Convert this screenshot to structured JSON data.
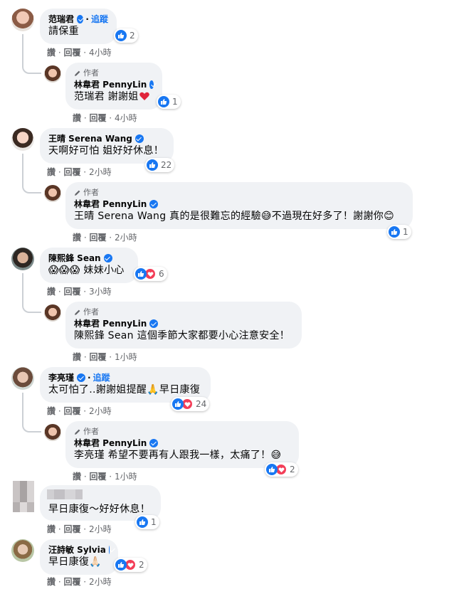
{
  "ui": {
    "follow_label": "追蹤",
    "author_badge": "作者",
    "like_label": "讚",
    "reply_label": "回覆",
    "sep": "·"
  },
  "comments": [
    {
      "name": "范瑞君",
      "verified": true,
      "follow": true,
      "text": "請保重",
      "time": "4小時",
      "reactions": [
        "like"
      ],
      "count": "2",
      "reply": {
        "name": "林韋君 PennyLin",
        "mention": "范瑞君",
        "text": "謝謝姐",
        "emoji": "heart",
        "time": "4小時",
        "reactions": [
          "like"
        ],
        "count": "1"
      }
    },
    {
      "name": "王晴 Serena Wang",
      "verified": true,
      "follow": false,
      "text": "天啊好可怕 姐好好休息！",
      "time": "2小時",
      "reactions": [
        "like"
      ],
      "count": "22",
      "reply": {
        "name": "林韋君 PennyLin",
        "mention": "王晴 Serena Wang",
        "text": "真的是很難忘的經驗😅不過現在好多了！謝謝你😊",
        "time": "2小時",
        "reactions": [
          "like"
        ],
        "count": "1"
      }
    },
    {
      "name": "陳熙鋒 Sean",
      "verified": true,
      "follow": false,
      "text": "😱😱😱 妹妹小心",
      "time": "3小時",
      "reactions": [
        "like",
        "heart"
      ],
      "count": "6",
      "reply": {
        "name": "林韋君 PennyLin",
        "mention": "陳熙鋒 Sean",
        "text": "這個季節大家都要小心注意安全！",
        "time": "1小時",
        "reactions": [],
        "count": ""
      }
    },
    {
      "name": "李亮瑾",
      "verified": true,
      "follow": true,
      "text": "太可怕了..謝謝姐提醒🙏早日康復",
      "time": "2小時",
      "reactions": [
        "like",
        "heart"
      ],
      "count": "24",
      "reply": {
        "name": "林韋君 PennyLin",
        "mention": "李亮瑾",
        "text": "希望不要再有人跟我一樣，太痛了！😅",
        "time": "1小時",
        "reactions": [
          "like",
          "heart"
        ],
        "count": "2"
      }
    },
    {
      "name": "",
      "verified": false,
      "follow": false,
      "blurred": true,
      "text": "早日康復～好好休息！",
      "time": "2小時",
      "reactions": [
        "like"
      ],
      "count": "1"
    },
    {
      "name": "汪詩敏 Sylvia",
      "verified": true,
      "follow": false,
      "text": "早日康復🙏🏻",
      "time": "2小時",
      "reactions": [
        "like",
        "heart"
      ],
      "count": "2"
    }
  ],
  "colors": {
    "bubble": "#f0f2f5",
    "link": "#1877f2",
    "meta": "#65676b",
    "heart": "#f33e58"
  }
}
